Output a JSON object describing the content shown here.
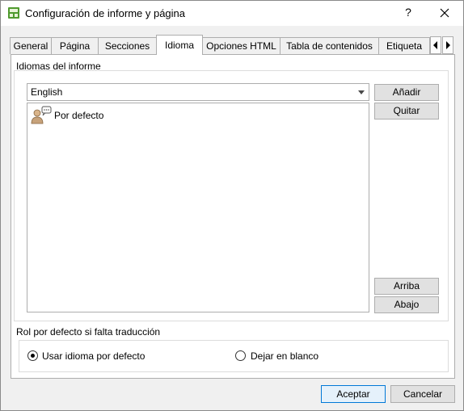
{
  "window": {
    "title": "Configuración de informe y página",
    "help_label": "?"
  },
  "tabs": [
    {
      "label": "General"
    },
    {
      "label": "Página"
    },
    {
      "label": "Secciones"
    },
    {
      "label": "Idioma",
      "active": true
    },
    {
      "label": "Opciones HTML"
    },
    {
      "label": "Tabla de contenidos"
    },
    {
      "label": "Etiqueta"
    }
  ],
  "languages_group": {
    "title": "Idiomas del informe",
    "selected_language": "English",
    "items": [
      {
        "label": "Por defecto",
        "icon": "person-speech-icon"
      }
    ],
    "buttons": {
      "add": "Añadir",
      "remove": "Quitar",
      "up": "Arriba",
      "down": "Abajo"
    }
  },
  "fallback_group": {
    "title": "Rol por defecto si falta traducción",
    "options": [
      {
        "label": "Usar idioma por defecto",
        "checked": true
      },
      {
        "label": "Dejar en blanco",
        "checked": false
      }
    ]
  },
  "footer": {
    "ok_label": "Aceptar",
    "cancel_label": "Cancelar"
  },
  "colors": {
    "accent": "#0078d7",
    "app_icon": "#4f9a2e"
  }
}
